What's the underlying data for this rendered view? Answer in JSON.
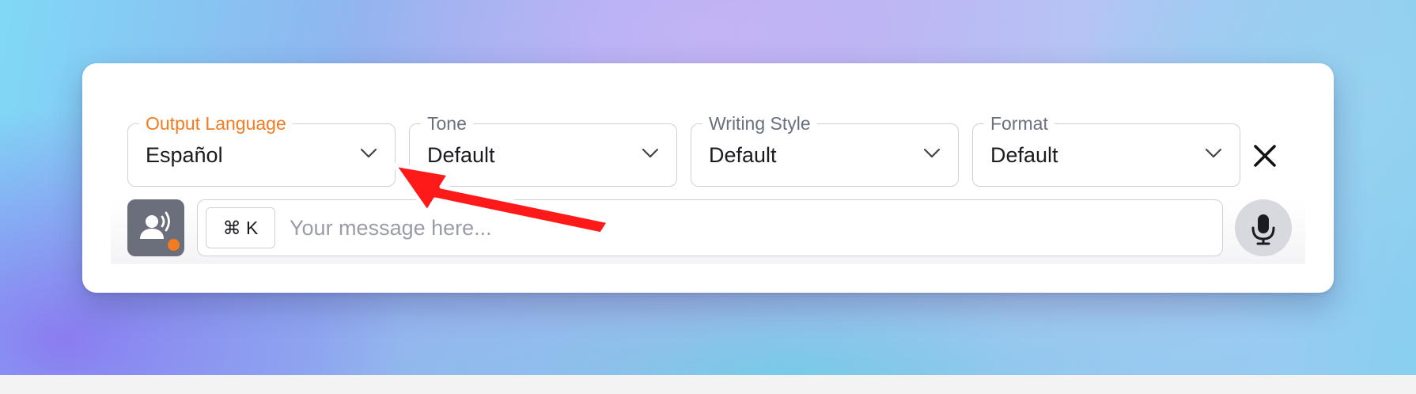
{
  "filters": [
    {
      "label": "Output Language",
      "value": "Español",
      "active": true
    },
    {
      "label": "Tone",
      "value": "Default",
      "active": false
    },
    {
      "label": "Writing Style",
      "value": "Default",
      "active": false
    },
    {
      "label": "Format",
      "value": "Default",
      "active": false
    }
  ],
  "composer": {
    "shortcut": "⌘ K",
    "placeholder": "Your message here...",
    "value": ""
  },
  "icons": {
    "close": "close-icon",
    "chevron": "chevron-down-icon",
    "voice": "voice-speaker-icon",
    "mic": "microphone-icon"
  },
  "colors": {
    "accent": "#f47b20",
    "annotation_arrow": "#ff1a1a",
    "voice_button": "#6b6f7b",
    "border": "#cfd1d8"
  }
}
